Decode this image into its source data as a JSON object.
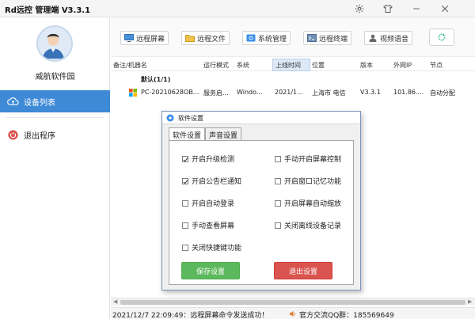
{
  "app": {
    "title": "Rd远控  管理端 V3.3.1"
  },
  "sidebar": {
    "org_name": "威航软件园",
    "items": [
      {
        "label": "设备列表",
        "icon": "cloud-upload-icon"
      },
      {
        "label": "退出程序",
        "icon": "power-icon"
      }
    ]
  },
  "toolbar": {
    "buttons": [
      {
        "label": "远程屏幕",
        "icon": "monitor-icon"
      },
      {
        "label": "远程文件",
        "icon": "folder-icon"
      },
      {
        "label": "系统管理",
        "icon": "gear-icon"
      },
      {
        "label": "远程终端",
        "icon": "terminal-icon"
      },
      {
        "label": "视频语音",
        "icon": "user-icon"
      }
    ]
  },
  "table": {
    "columns": [
      "备注/机器名",
      "运行模式",
      "系统",
      "上线时间",
      "位置",
      "版本",
      "外网IP",
      "节点"
    ],
    "group_label": "默认(1/1)",
    "rows": [
      {
        "name": "PC-20210628OB...",
        "mode": "服务启...",
        "os": "Windo...",
        "time": "2021/1...",
        "location": "上海市 电信",
        "version": "V3.3.1",
        "ip": "101.86....",
        "node": "自动分配"
      }
    ]
  },
  "status": {
    "message": "2021/12/7 22:09:49：远程屏幕命令发送成功！",
    "contact": "官方交流QQ群：185569649"
  },
  "dialog": {
    "title": "软件设置",
    "tabs": [
      "软件设置",
      "声音设置"
    ],
    "options_left": [
      {
        "label": "开启升级检测",
        "checked": true
      },
      {
        "label": "开启公告栏通知",
        "checked": true
      },
      {
        "label": "开启自动登录",
        "checked": false
      },
      {
        "label": "手动查看屏幕",
        "checked": false
      },
      {
        "label": "关闭快捷键功能",
        "checked": false
      }
    ],
    "options_right": [
      {
        "label": "手动开启屏幕控制",
        "checked": false
      },
      {
        "label": "开启窗口记忆功能",
        "checked": false
      },
      {
        "label": "开启屏幕自动缩放",
        "checked": false
      },
      {
        "label": "关闭离线设备记录",
        "checked": false
      }
    ],
    "save_label": "保存设置",
    "exit_label": "退出设置"
  },
  "colors": {
    "accent": "#3e8ad6",
    "save": "#5cb85c",
    "exit": "#d9534f"
  }
}
